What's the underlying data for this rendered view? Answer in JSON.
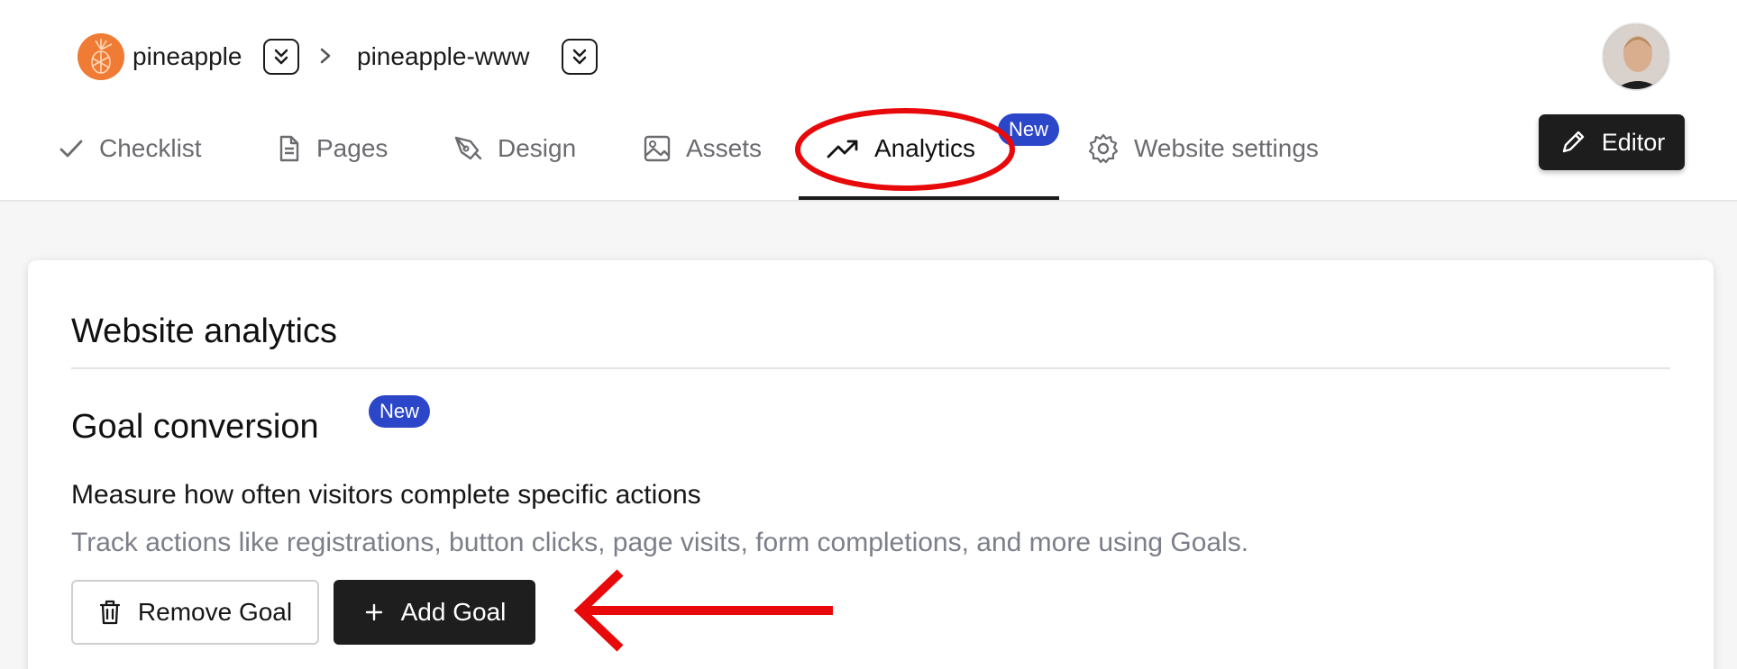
{
  "breadcrumb": {
    "workspace": "pineapple",
    "site": "pineapple-www"
  },
  "nav": {
    "tabs": [
      {
        "label": "Checklist",
        "icon": "check-icon"
      },
      {
        "label": "Pages",
        "icon": "document-icon"
      },
      {
        "label": "Design",
        "icon": "pen-tool-icon"
      },
      {
        "label": "Assets",
        "icon": "image-icon"
      },
      {
        "label": "Analytics",
        "icon": "trending-up-icon",
        "active": true
      },
      {
        "label": "Website settings",
        "icon": "gear-icon"
      }
    ],
    "analytics_badge": "New"
  },
  "editor_button": {
    "label": "Editor",
    "icon": "pencil-icon"
  },
  "main": {
    "title": "Website analytics",
    "section_title": "Goal conversion",
    "section_badge": "New",
    "description": "Measure how often visitors complete specific actions",
    "subdescription": "Track actions like registrations, button clicks, page visits, form completions, and more using Goals.",
    "remove_button": "Remove Goal",
    "add_button": "Add Goal"
  },
  "colors": {
    "logo": "#f07b35",
    "badge": "#2b46c9",
    "dark_button": "#1e1e1e",
    "annotation_red": "#e8090b"
  }
}
